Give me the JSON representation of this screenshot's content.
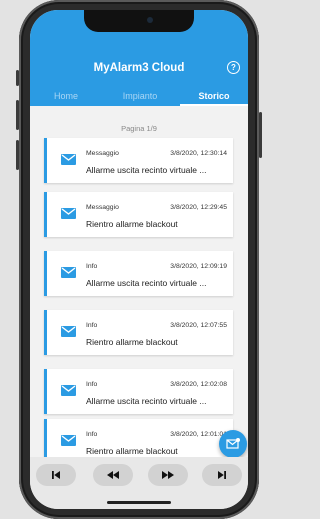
{
  "app": {
    "title": "MyAlarm3 Cloud",
    "help_label": "?"
  },
  "tabs": [
    {
      "label": "Home"
    },
    {
      "label": "Impianto"
    },
    {
      "label": "Storico"
    }
  ],
  "pagination": {
    "label": "Pagina 1/9"
  },
  "messages": [
    {
      "type": "Messaggio",
      "date": "3/8/2020, 12:30:14",
      "text": "Allarme uscita recinto virtuale ..."
    },
    {
      "type": "Messaggio",
      "date": "3/8/2020, 12:29:45",
      "text": "Rientro allarme blackout"
    },
    {
      "type": "Info",
      "date": "3/8/2020, 12:09:19",
      "text": "Allarme uscita recinto virtuale ..."
    },
    {
      "type": "Info",
      "date": "3/8/2020, 12:07:55",
      "text": "Rientro allarme blackout"
    },
    {
      "type": "Info",
      "date": "3/8/2020, 12:02:08",
      "text": "Allarme uscita recinto virtuale ..."
    },
    {
      "type": "Info",
      "date": "3/8/2020, 12:01:01",
      "text": "Rientro allarme blackout"
    }
  ],
  "colors": {
    "accent": "#2b9be3",
    "background": "#f2f2f2"
  },
  "icons": {
    "message": "mail-icon",
    "fab": "compose-mail-icon"
  },
  "pager_buttons": [
    "first-page",
    "previous-page",
    "next-page",
    "last-page"
  ]
}
